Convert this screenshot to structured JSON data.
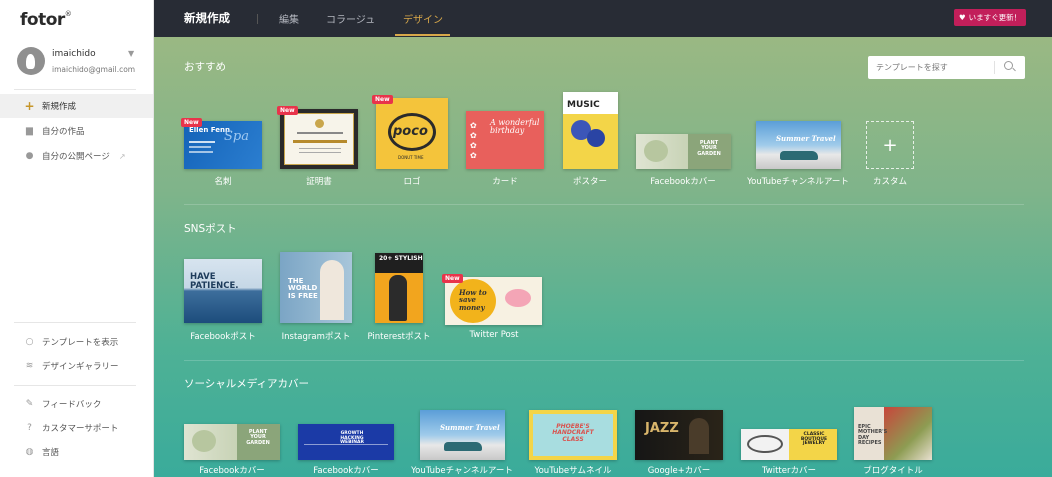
{
  "sidebar": {
    "logo": "fotor",
    "logo_mark": "®",
    "user": {
      "name": "imaichido",
      "email": "imaichido@gmail.com"
    },
    "nav": [
      {
        "label": "新規作成",
        "icon": "plus-icon"
      },
      {
        "label": "自分の作品",
        "icon": "folder-icon"
      },
      {
        "label": "自分の公開ページ",
        "icon": "users-icon"
      }
    ],
    "bottom": [
      {
        "label": "テンプレートを表示",
        "icon": "search-icon"
      },
      {
        "label": "デザインギャラリー",
        "icon": "layers-icon"
      },
      {
        "label": "フィードバック",
        "icon": "edit-icon"
      },
      {
        "label": "カスタマーサポート",
        "icon": "help-icon"
      },
      {
        "label": "言語",
        "icon": "globe-icon"
      }
    ]
  },
  "topbar": {
    "title": "新規作成",
    "tabs": [
      "編集",
      "コラージュ",
      "デザイン"
    ],
    "active_tab": "デザイン",
    "upgrade": "いますぐ更新！"
  },
  "search": {
    "placeholder": "テンプレートを探す"
  },
  "sections": {
    "recommended": {
      "title": "おすすめ",
      "items": [
        "名刺",
        "証明書",
        "ロゴ",
        "カード",
        "ポスター",
        "Facebookカバー",
        "YouTubeチャンネルアート",
        "カスタム"
      ],
      "badge": "New"
    },
    "sns": {
      "title": "SNSポスト",
      "items": [
        "Facebookポスト",
        "Instagramポスト",
        "Pinterestポスト",
        "Twitter Post"
      ]
    },
    "social_cover": {
      "title": "ソーシャルメディアカバー",
      "items": [
        "Facebookカバー",
        "Facebookカバー",
        "YouTubeチャンネルアート",
        "YouTubeサムネイル",
        "Google+カバー",
        "Twitterカバー",
        "ブログタイトル"
      ]
    }
  },
  "thumb_text": {
    "card_name": "Ellen Fenn",
    "logo": "poco",
    "logo_sub": "DONUT TIME",
    "card": "A wonderful birthday",
    "poster": "MUSIC",
    "fb_cover": "PLANT YOUR GARDEN",
    "yt_art": "Summer Travel",
    "fb_post": "HAVE PATIENCE.",
    "insta": "THE WORLD IS FREE",
    "pin": "20+ STYLISH",
    "twitter": "How to save money",
    "fb_cover2": "GROWTH HACKING WEBINAR",
    "yt_thumb": "PHOEBE'S HANDCRAFT CLASS",
    "gplus": "JAZZ",
    "tw_cover": "CLASSIC BOUTIQUE JEWELRY",
    "blog": "EPIC MOTHER'S DAY RECIPES"
  },
  "colors": {
    "topbar": "#282c35",
    "accent": "#d8a84a",
    "upgrade": "#c21f5a",
    "new_badge": "#e8344b"
  }
}
